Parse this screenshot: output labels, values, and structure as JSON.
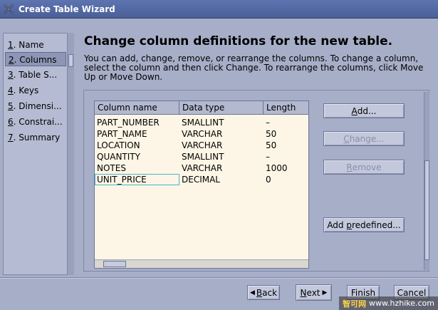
{
  "window": {
    "title": "Create Table Wizard",
    "icon": "wizard-icon"
  },
  "steps": [
    {
      "num": "1",
      "label": "Name"
    },
    {
      "num": "2",
      "label": "Columns"
    },
    {
      "num": "3",
      "label": "Table S..."
    },
    {
      "num": "4",
      "label": "Keys"
    },
    {
      "num": "5",
      "label": "Dimensi..."
    },
    {
      "num": "6",
      "label": "Constrai..."
    },
    {
      "num": "7",
      "label": "Summary"
    }
  ],
  "active_step": 2,
  "main": {
    "heading": "Change column definitions for the new table.",
    "description": "You can add, change, remove, or rearrange the columns. To change a column, select the column and then click Change. To rearrange the columns, click Move Up or Move Down."
  },
  "table": {
    "headers": [
      "Column name",
      "Data type",
      "Length"
    ],
    "rows": [
      [
        "PART_NUMBER",
        "SMALLINT",
        "–"
      ],
      [
        "PART_NAME",
        "VARCHAR",
        "50"
      ],
      [
        "LOCATION",
        "VARCHAR",
        "50"
      ],
      [
        "QUANTITY",
        "SMALLINT",
        "–"
      ],
      [
        "NOTES",
        "VARCHAR",
        "1000"
      ],
      [
        "UNIT_PRICE",
        "DECIMAL",
        "0"
      ]
    ],
    "selected_row": 5
  },
  "buttons": {
    "add": {
      "first": "A",
      "rest": "dd..."
    },
    "change": {
      "first": "C",
      "rest": "hange..."
    },
    "remove": {
      "first": "R",
      "rest": "emove"
    },
    "add_predefined": {
      "pre": "Add ",
      "first": "p",
      "rest": "redefined..."
    }
  },
  "footer": {
    "back_first": "B",
    "back_rest": "ack",
    "next_first": "N",
    "next_rest": "ext",
    "finish": "Finish",
    "cancel": "Cancel"
  },
  "watermark": {
    "text": "智可网",
    "url": "www.hzhike.com"
  }
}
